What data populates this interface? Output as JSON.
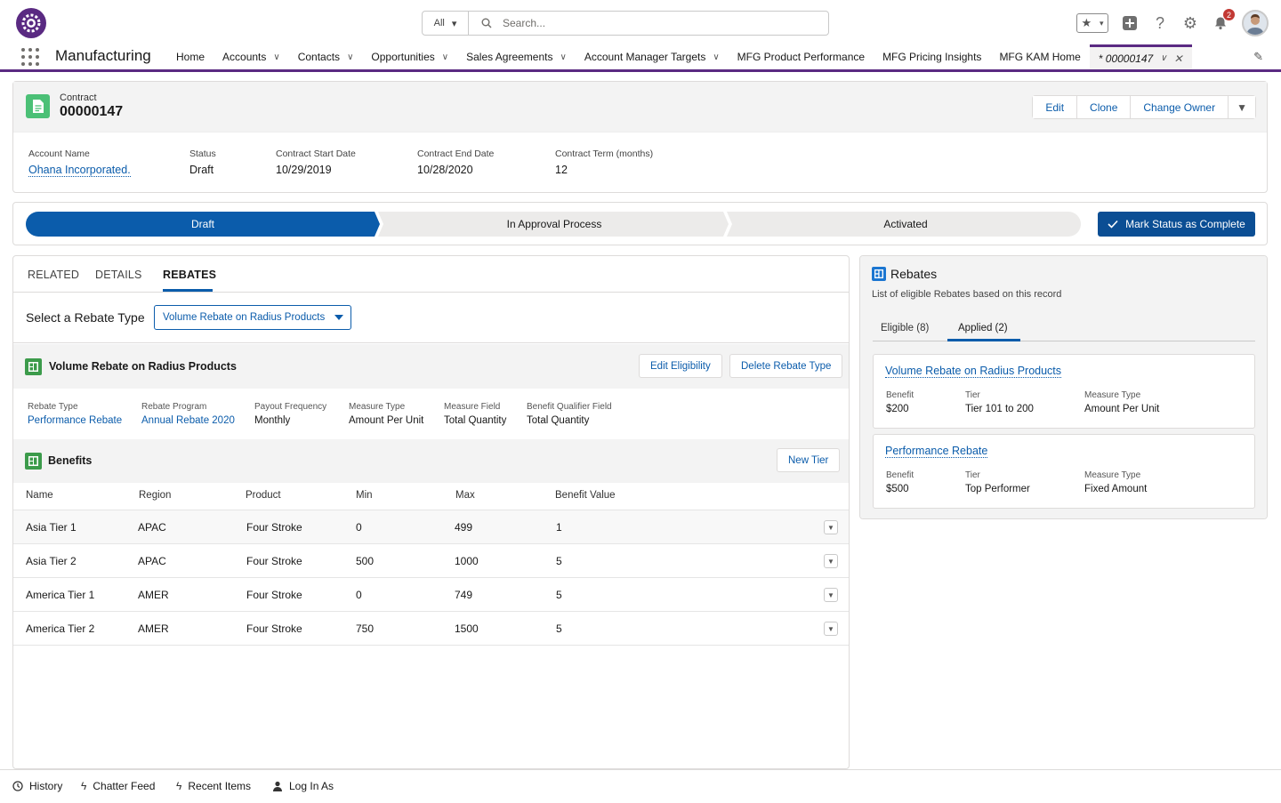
{
  "header": {
    "search": {
      "scope": "All",
      "placeholder": "Search..."
    },
    "notification_count": "2",
    "icons": [
      "favorites-icon",
      "add-icon",
      "help-icon",
      "setup-icon",
      "notifications-icon",
      "avatar"
    ]
  },
  "nav": {
    "app_name": "Manufacturing",
    "items": [
      {
        "label": "Home",
        "has_menu": false
      },
      {
        "label": "Accounts",
        "has_menu": true
      },
      {
        "label": "Contacts",
        "has_menu": true
      },
      {
        "label": "Opportunities",
        "has_menu": true
      },
      {
        "label": "Sales Agreements",
        "has_menu": true
      },
      {
        "label": "Account Manager Targets",
        "has_menu": true
      },
      {
        "label": "MFG Product Performance",
        "has_menu": false
      },
      {
        "label": "MFG Pricing Insights",
        "has_menu": false
      },
      {
        "label": "MFG KAM Home",
        "has_menu": false
      }
    ],
    "active_tab": {
      "label": "* 00000147"
    }
  },
  "record": {
    "type": "Contract",
    "title": "00000147",
    "actions": [
      "Edit",
      "Clone",
      "Change Owner"
    ],
    "highlights": [
      {
        "label": "Account Name",
        "value": "Ohana Incorporated.",
        "link": true
      },
      {
        "label": "Status",
        "value": "Draft",
        "link": false
      },
      {
        "label": "Contract Start Date",
        "value": "10/29/2019",
        "link": false
      },
      {
        "label": "Contract End Date",
        "value": "10/28/2020",
        "link": false
      },
      {
        "label": "Contract Term (months)",
        "value": "12",
        "link": false
      }
    ]
  },
  "path": {
    "stages": [
      {
        "label": "Draft",
        "state": "current"
      },
      {
        "label": "In Approval Process",
        "state": "incomplete"
      },
      {
        "label": "Activated",
        "state": "incomplete"
      }
    ],
    "mark_button": "Mark Status as Complete"
  },
  "tabs": {
    "items": [
      "RELATED",
      "DETAILS",
      "REBATES"
    ],
    "active": "REBATES"
  },
  "rebate_select": {
    "label": "Select a Rebate Type",
    "value": "Volume Rebate on Radius Products"
  },
  "rebate_section": {
    "title": "Volume Rebate on Radius Products",
    "edit_button": "Edit Eligibility",
    "delete_button": "Delete Rebate Type",
    "fields": [
      {
        "label": "Rebate Type",
        "value": "Performance Rebate",
        "link": true
      },
      {
        "label": "Rebate Program",
        "value": "Annual Rebate 2020",
        "link": true
      },
      {
        "label": "Payout Frequency",
        "value": "Monthly",
        "link": false
      },
      {
        "label": "Measure Type",
        "value": "Amount Per Unit",
        "link": false
      },
      {
        "label": "Measure Field",
        "value": "Total Quantity",
        "link": false
      },
      {
        "label": "Benefit Qualifier Field",
        "value": "Total Quantity",
        "link": false
      }
    ]
  },
  "benefits": {
    "title": "Benefits",
    "new_button": "New Tier",
    "columns": [
      "Name",
      "Region",
      "Product",
      "Min",
      "Max",
      "Benefit Value"
    ],
    "rows": [
      [
        "Asia Tier 1",
        "APAC",
        "Four Stroke",
        "0",
        "499",
        "1"
      ],
      [
        "Asia Tier 2",
        "APAC",
        "Four Stroke",
        "500",
        "1000",
        "5"
      ],
      [
        "America Tier 1",
        "AMER",
        "Four Stroke",
        "0",
        "749",
        "5"
      ],
      [
        "America Tier 2",
        "AMER",
        "Four Stroke",
        "750",
        "1500",
        "5"
      ]
    ]
  },
  "rebates_panel": {
    "title": "Rebates",
    "subtitle": "List of eligible Rebates based on this record",
    "tabs": [
      "Eligible (8)",
      "Applied (2)"
    ],
    "active_tab": "Applied (2)",
    "cards": [
      {
        "title": "Volume Rebate on Radius Products",
        "fields": [
          {
            "label": "Benefit",
            "value": "$200"
          },
          {
            "label": "Tier",
            "value": "Tier 101 to 200"
          },
          {
            "label": "Measure Type",
            "value": "Amount Per Unit"
          }
        ]
      },
      {
        "title": "Performance Rebate",
        "fields": [
          {
            "label": "Benefit",
            "value": "$500"
          },
          {
            "label": "Tier",
            "value": "Top Performer"
          },
          {
            "label": "Measure Type",
            "value": "Fixed Amount"
          }
        ]
      }
    ]
  },
  "utility": {
    "items": [
      {
        "label": "History",
        "icon": "clock-icon"
      },
      {
        "label": "Chatter Feed",
        "icon": "bolt-icon"
      },
      {
        "label": "Recent Items",
        "icon": "bolt-icon"
      },
      {
        "label": "Log In As",
        "icon": "user-icon"
      }
    ]
  },
  "colors": {
    "brand": "#5a2a82",
    "link": "#0b5cab",
    "path_current": "#0b5cab",
    "mark_button": "#0b4e94"
  }
}
